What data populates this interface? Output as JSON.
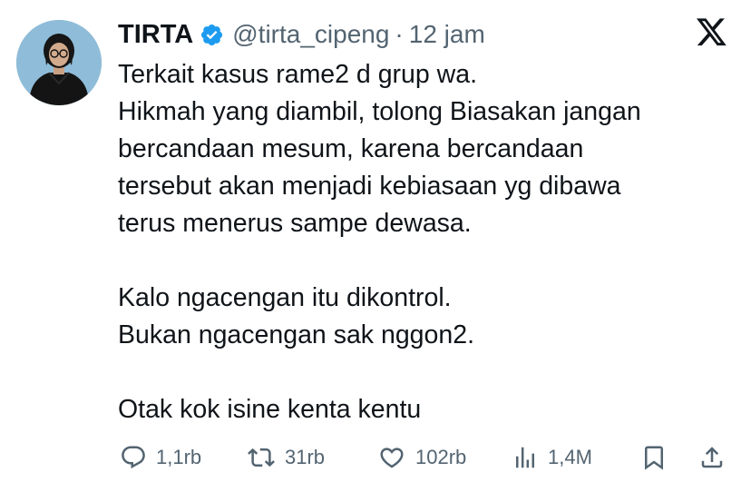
{
  "tweet": {
    "author_name": "TIRTA",
    "handle": "@tirta_cipeng",
    "separator": "·",
    "time": "12 jam",
    "paragraphs": [
      [
        "Terkait kasus rame2 d grup wa.",
        "Hikmah yang diambil, tolong Biasakan jangan",
        "bercandaan mesum, karena bercandaan",
        "tersebut akan menjadi kebiasaan yg dibawa",
        "terus menerus sampe dewasa."
      ],
      [
        "Kalo ngacengan itu dikontrol.",
        "Bukan ngacengan sak nggon2."
      ],
      [
        "Otak kok isine kenta kentu"
      ]
    ],
    "stats": {
      "replies": "1,1rb",
      "reposts": "31rb",
      "likes": "102rb",
      "views": "1,4M"
    }
  },
  "icons": {
    "verified": "verified-badge-icon",
    "logo": "x-logo-icon",
    "reply": "reply-icon",
    "repost": "repost-icon",
    "like": "heart-icon",
    "views": "views-icon",
    "bookmark": "bookmark-icon",
    "share": "share-icon"
  },
  "colors": {
    "verified_badge": "#1d9bf0",
    "text_primary": "#0f1419",
    "text_secondary": "#536471",
    "background": "#ffffff"
  }
}
